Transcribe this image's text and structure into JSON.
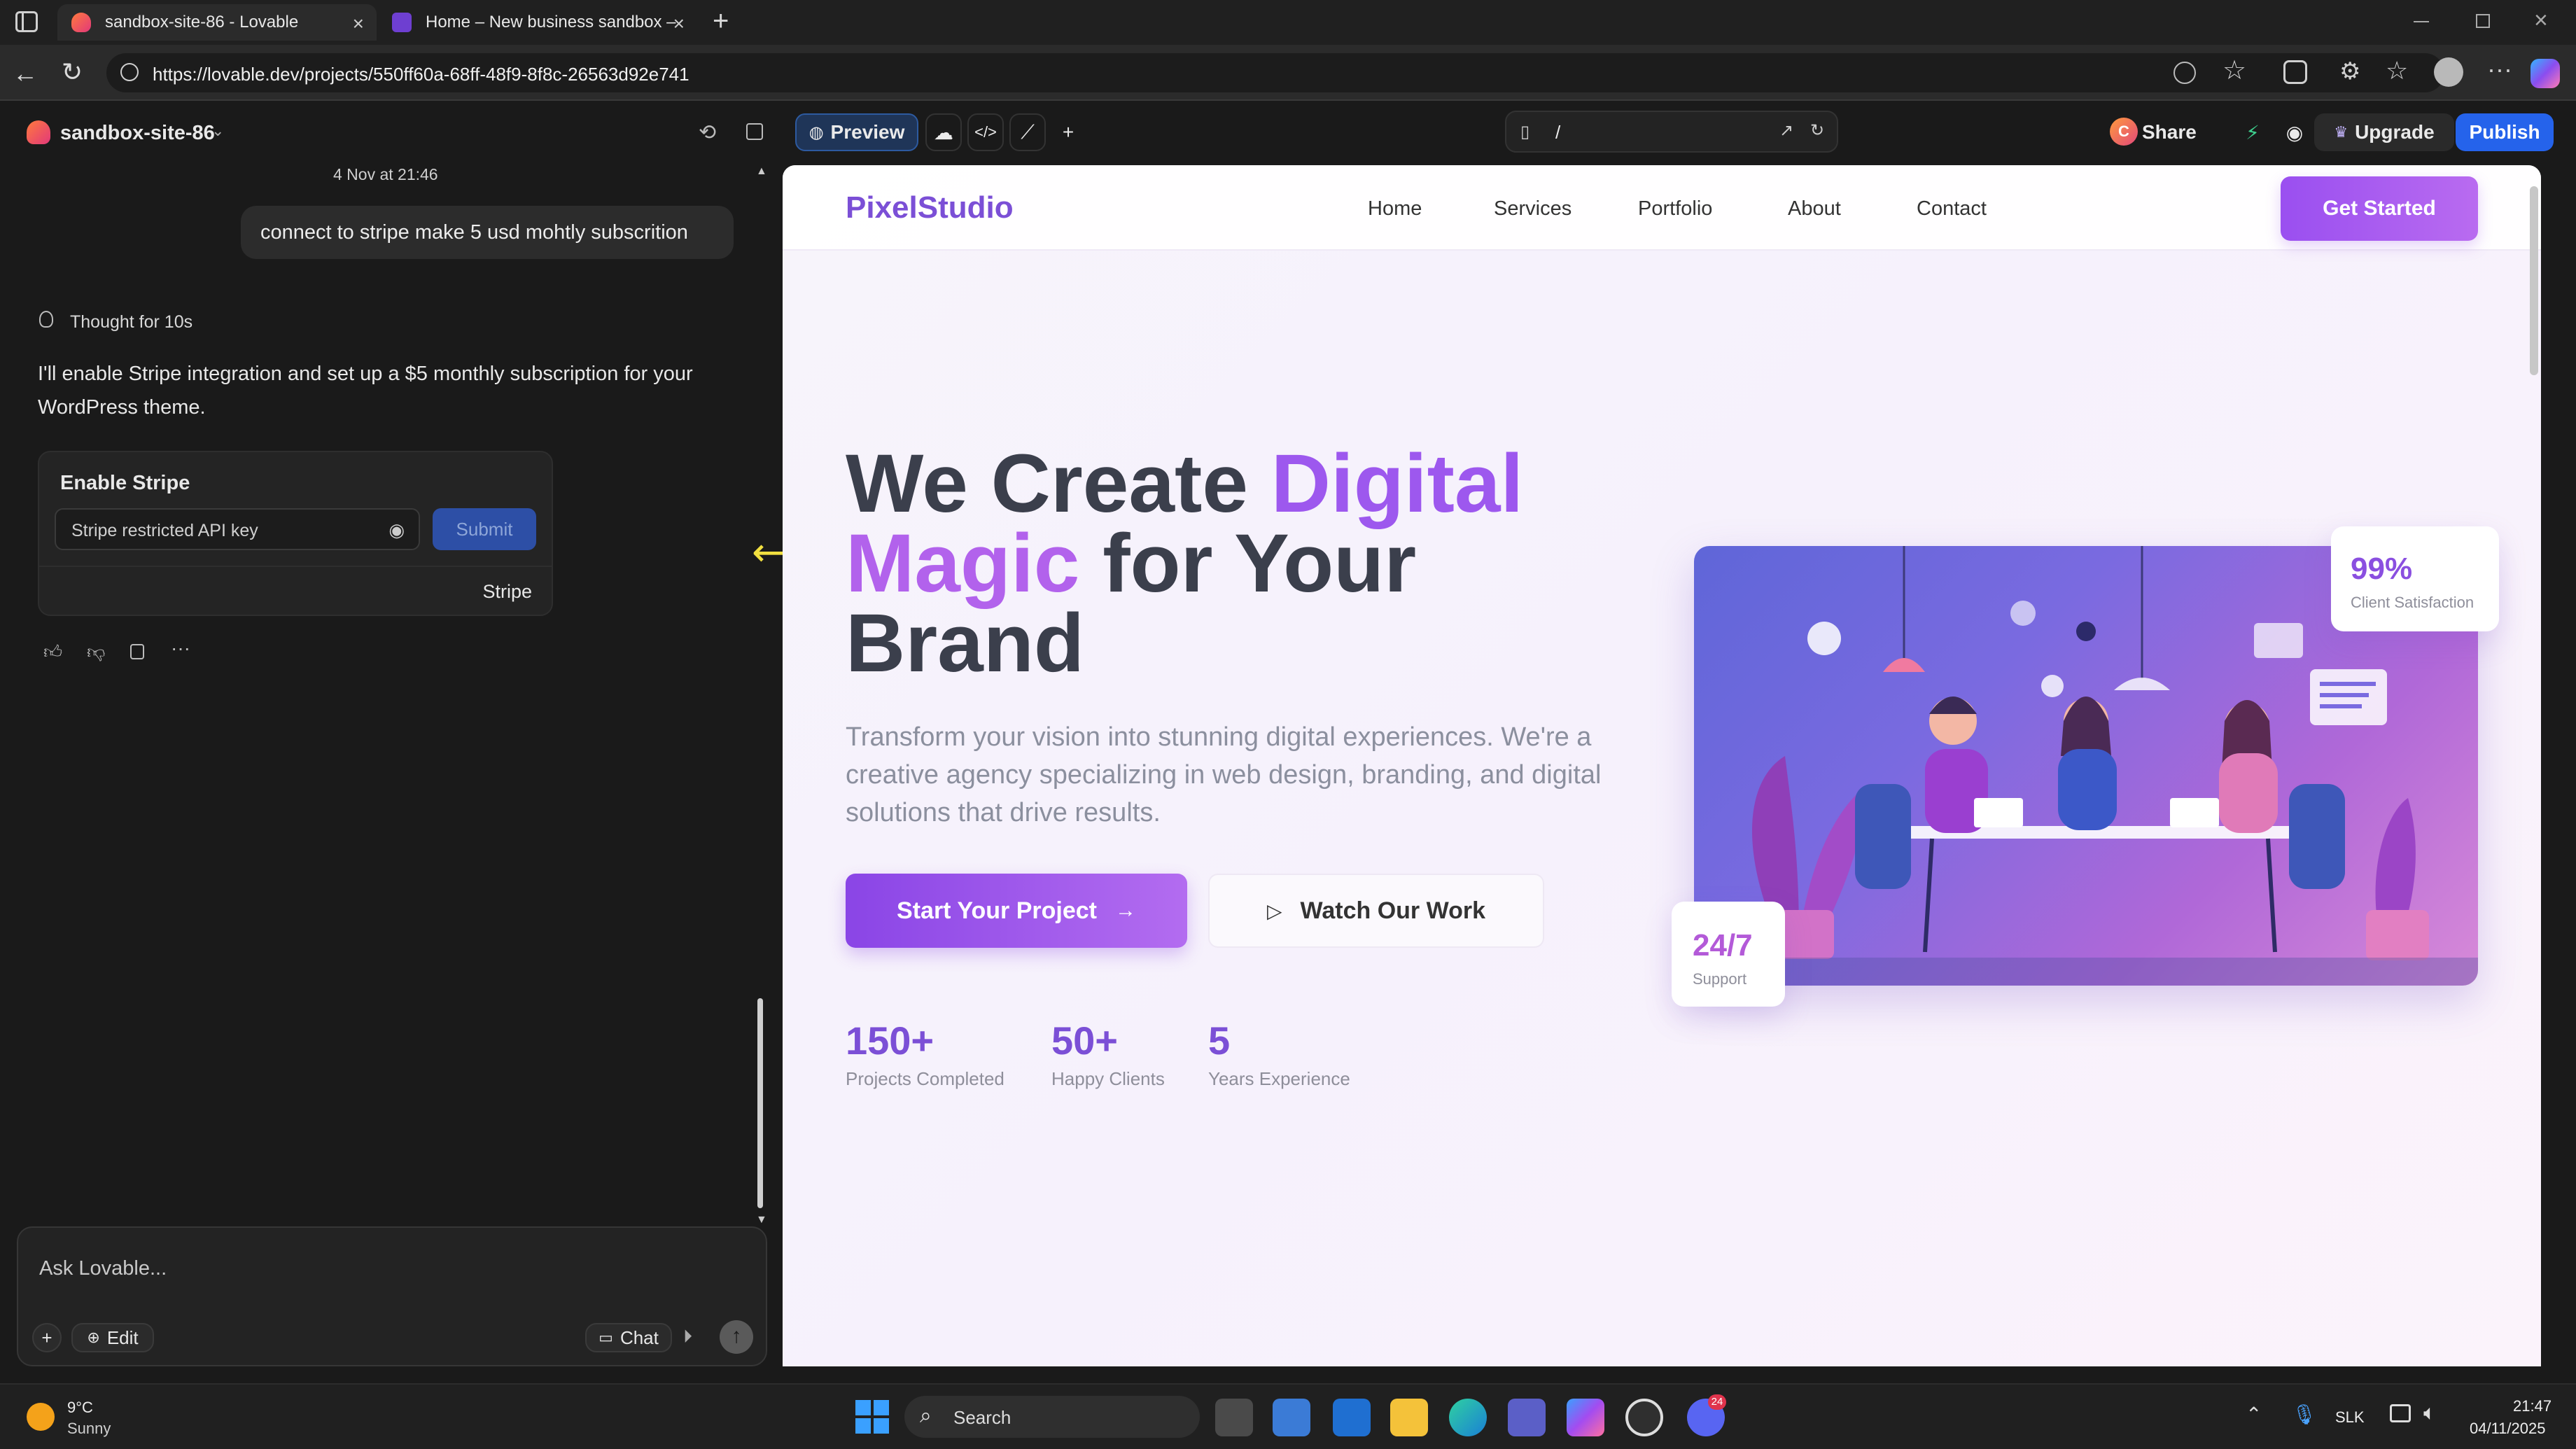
{
  "browser": {
    "tabs": [
      {
        "title": "sandbox-site-86 - Lovable",
        "active": true
      },
      {
        "title": "Home – New business sandbox –",
        "active": false
      }
    ],
    "url": "https://lovable.dev/projects/550ff60a-68ff-48f9-8f8c-26563d92e741"
  },
  "lovable": {
    "project_name": "sandbox-site-86",
    "toolbar": {
      "preview_label": "Preview",
      "route": "/",
      "share_label": "Share",
      "avatar_letter": "C",
      "upgrade_label": "Upgrade",
      "publish_label": "Publish"
    },
    "chat": {
      "timestamp": "4 Nov at 21:46",
      "user_message": "connect to stripe make 5 usd mohtly subscrition",
      "thought": "Thought for 10s",
      "reply_line1": "I'll enable Stripe integration and set up a $5 monthly subscription for your",
      "reply_line2": "WordPress theme.",
      "stripe_card": {
        "title": "Enable Stripe",
        "input_placeholder": "Stripe restricted API key",
        "submit_label": "Submit",
        "footer_label": "Stripe"
      },
      "composer": {
        "placeholder": "Ask Lovable...",
        "edit_label": "Edit",
        "chat_label": "Chat"
      }
    }
  },
  "site": {
    "logo": "PixelStudio",
    "nav": [
      "Home",
      "Services",
      "Portfolio",
      "About",
      "Contact"
    ],
    "cta": "Get Started",
    "hero": {
      "l1_plain": "We Create ",
      "l1_accent": "Digital",
      "l2_accent": "Magic",
      "l2_plain": " for Your",
      "l3_plain": "Brand",
      "sub1": "Transform your vision into stunning digital experiences. We're a",
      "sub2": "creative agency specializing in web design, branding, and digital",
      "sub3": "solutions that drive results.",
      "primary_btn": "Start Your Project",
      "secondary_btn": "Watch Our Work"
    },
    "stats": [
      {
        "value": "150+",
        "label": "Projects Completed"
      },
      {
        "value": "50+",
        "label": "Happy Clients"
      },
      {
        "value": "5",
        "label": "Years Experience"
      }
    ],
    "badges": {
      "satisfaction_value": "99%",
      "satisfaction_label": "Client Satisfaction",
      "support_value": "24/7",
      "support_label": "Support"
    }
  },
  "taskbar": {
    "weather_temp": "9°C",
    "weather_desc": "Sunny",
    "search_label": "Search",
    "lang": "SLK",
    "time": "21:47",
    "date": "04/11/2025",
    "discord_badge": "24"
  },
  "colors": {
    "accent_purple": "#8b5cf6",
    "publish_blue": "#2563eb",
    "submit_blue": "#2d4fa6"
  }
}
